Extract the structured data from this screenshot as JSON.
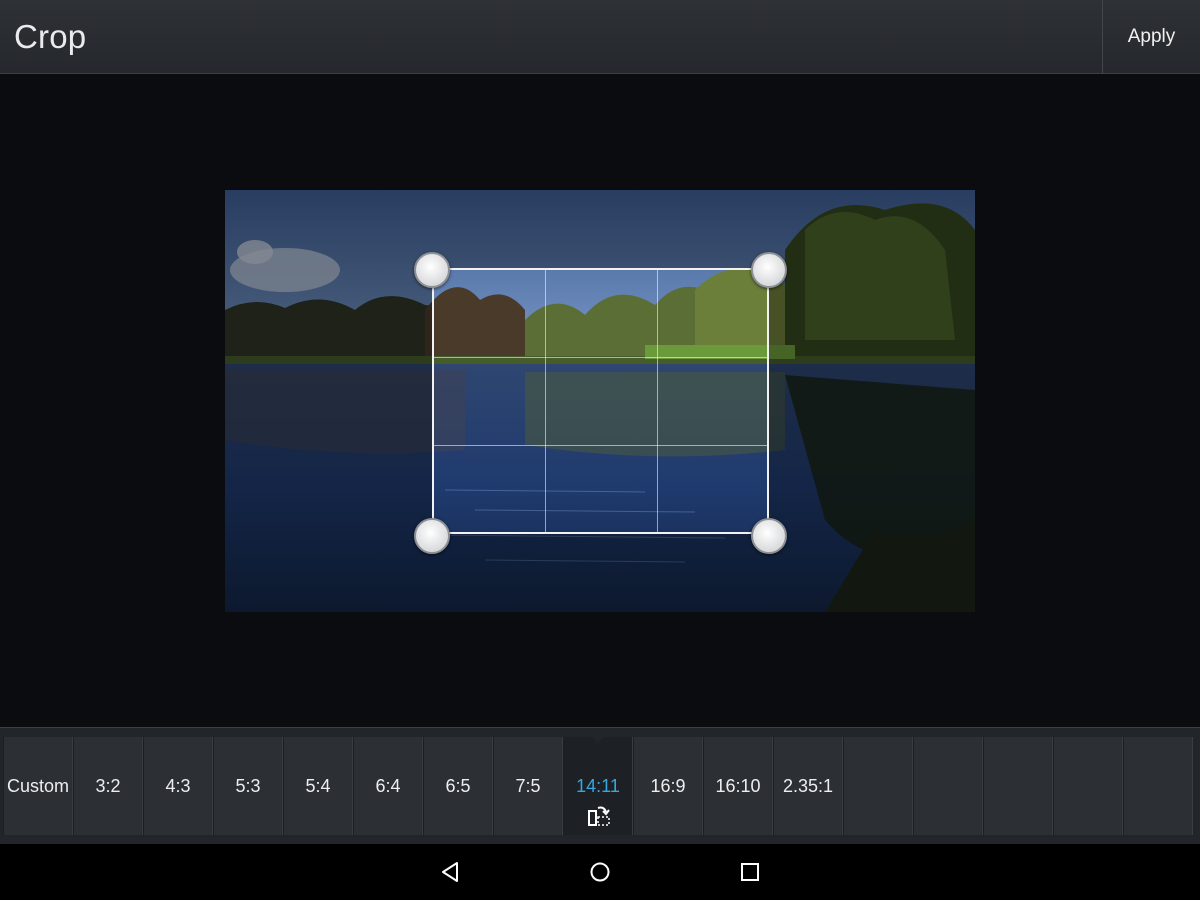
{
  "header": {
    "title": "Crop",
    "apply_label": "Apply"
  },
  "ratios": [
    {
      "label": "Custom"
    },
    {
      "label": "3:2"
    },
    {
      "label": "4:3"
    },
    {
      "label": "5:3"
    },
    {
      "label": "5:4"
    },
    {
      "label": "6:4"
    },
    {
      "label": "6:5"
    },
    {
      "label": "7:5"
    },
    {
      "label": "14:11",
      "selected": true
    },
    {
      "label": "16:9"
    },
    {
      "label": "16:10"
    },
    {
      "label": "2.35:1"
    },
    {
      "label": ""
    },
    {
      "label": ""
    },
    {
      "label": ""
    },
    {
      "label": ""
    },
    {
      "label": ""
    }
  ],
  "colors": {
    "accent": "#33a9e0"
  },
  "icons": {
    "rotate": "rotate-crop-icon",
    "back": "back-icon",
    "home": "home-icon",
    "recents": "recents-icon"
  }
}
